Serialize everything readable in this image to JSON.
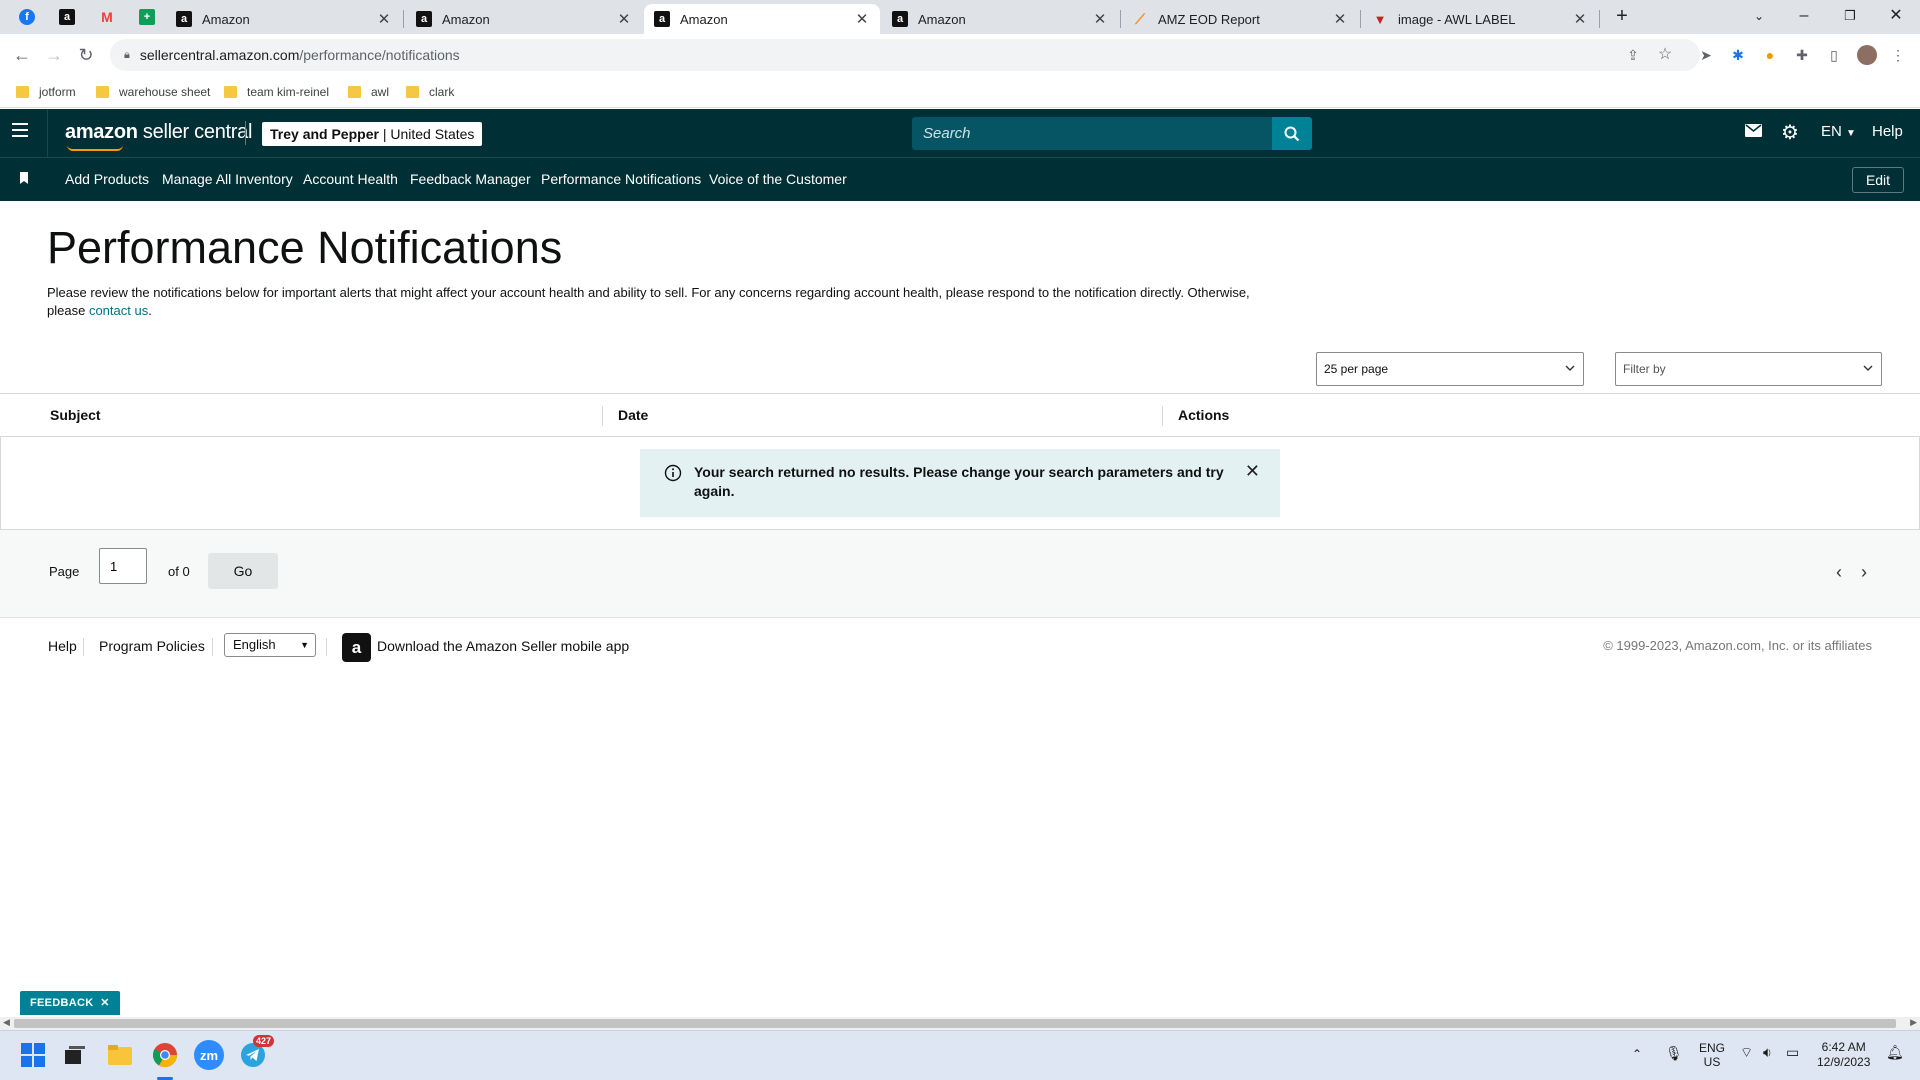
{
  "browser": {
    "tabs": [
      {
        "title": "Amazon",
        "active": false
      },
      {
        "title": "Amazon",
        "active": false
      },
      {
        "title": "Amazon",
        "active": true
      },
      {
        "title": "Amazon",
        "active": false
      },
      {
        "title": "AMZ EOD Report",
        "active": false
      },
      {
        "title": "image - AWL LABEL",
        "active": false
      }
    ],
    "url_host": "sellercentral.amazon.com",
    "url_path": "/performance/notifications",
    "bookmarks": [
      "jotform",
      "warehouse sheet",
      "team kim-reinel",
      "awl",
      "clark"
    ]
  },
  "header": {
    "logo_bold": "amazon",
    "logo_rest": " seller central",
    "store_name": "Trey and Pepper",
    "marketplace": "| United States",
    "search_placeholder": "Search",
    "language": "EN",
    "help": "Help"
  },
  "nav": {
    "links": [
      "Add Products",
      "Manage All Inventory",
      "Account Health",
      "Feedback Manager",
      "Performance Notifications",
      "Voice of the Customer"
    ],
    "edit": "Edit"
  },
  "main": {
    "title": "Performance Notifications",
    "description": "Please review the notifications below for important alerts that might affect your account health and ability to sell. For any concerns regarding account health, please respond to the notification directly. Otherwise, please",
    "contact_link": "contact us",
    "per_page": "25 per page",
    "filter_placeholder": "Filter by",
    "columns": [
      "Subject",
      "Date",
      "Actions"
    ],
    "alert_message": "Your search returned no results. Please change your search parameters and try again."
  },
  "pager": {
    "page_label": "Page",
    "page_value": "1",
    "of_label": "of 0",
    "go": "Go"
  },
  "footer": {
    "help": "Help",
    "program_policies": "Program Policies",
    "language": "English",
    "app_text": "Download the Amazon Seller mobile app",
    "copyright": "© 1999-2023, Amazon.com, Inc. or its affiliates"
  },
  "feedback_tab": "FEEDBACK",
  "taskbar": {
    "lang_top": "ENG",
    "lang_bottom": "US",
    "time": "6:42 AM",
    "date": "12/9/2023",
    "telegram_badge": "427",
    "zoom_label": "zm"
  },
  "colors": {
    "header_bg": "#002f36",
    "search_btn": "#008296",
    "link": "#007185",
    "alert_bg": "#e3f1f3"
  }
}
